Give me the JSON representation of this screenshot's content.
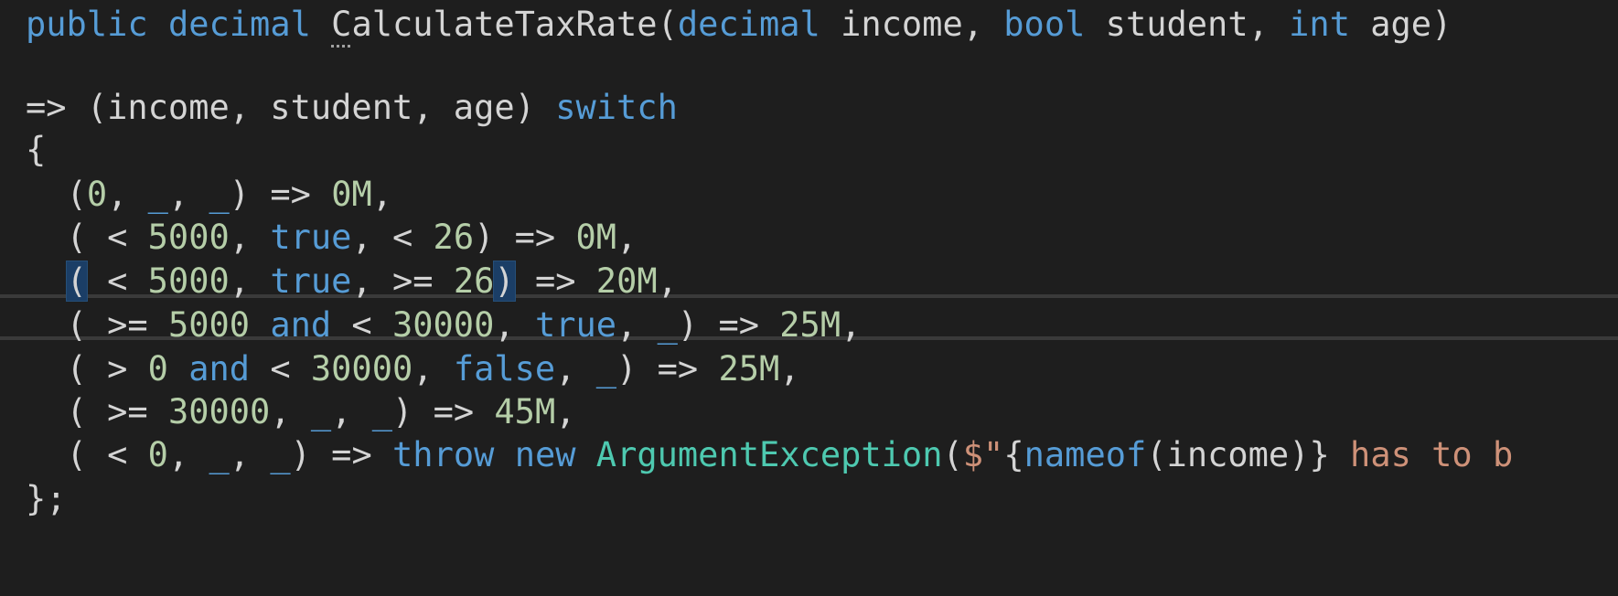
{
  "colors": {
    "background": "#1e1e1e",
    "default": "#d4d4d4",
    "keyword": "#569cd6",
    "number": "#b5cea8",
    "type": "#4ec9b0",
    "string": "#ce9178",
    "current_line_border": "#3a3a3a",
    "bracket_match": "#1b3e66"
  },
  "editor": {
    "lines": [
      {
        "tokens": [
          {
            "text": "public",
            "kind": "keyword"
          },
          {
            "text": " ",
            "kind": "default"
          },
          {
            "text": "decimal",
            "kind": "keyword"
          },
          {
            "text": " ",
            "kind": "default"
          },
          {
            "text": "C",
            "kind": "default",
            "dotted": true
          },
          {
            "text": "alculateTaxRate(",
            "kind": "default"
          },
          {
            "text": "decimal",
            "kind": "keyword"
          },
          {
            "text": " income, ",
            "kind": "default"
          },
          {
            "text": "bool",
            "kind": "keyword"
          },
          {
            "text": " student, ",
            "kind": "default"
          },
          {
            "text": "int",
            "kind": "keyword"
          },
          {
            "text": " age)",
            "kind": "default"
          }
        ]
      },
      {
        "tokens": []
      },
      {
        "tokens": [
          {
            "text": "=> (income, student, age) ",
            "kind": "default"
          },
          {
            "text": "switch",
            "kind": "keyword"
          }
        ]
      },
      {
        "tokens": [
          {
            "text": "{",
            "kind": "default"
          }
        ]
      },
      {
        "tokens": [
          {
            "text": "  (",
            "kind": "default"
          },
          {
            "text": "0",
            "kind": "number"
          },
          {
            "text": ", ",
            "kind": "default"
          },
          {
            "text": "_",
            "kind": "keyword"
          },
          {
            "text": ", ",
            "kind": "default"
          },
          {
            "text": "_",
            "kind": "keyword"
          },
          {
            "text": ") => ",
            "kind": "default"
          },
          {
            "text": "0M",
            "kind": "number"
          },
          {
            "text": ",",
            "kind": "default"
          }
        ]
      },
      {
        "tokens": [
          {
            "text": "  ( < ",
            "kind": "default"
          },
          {
            "text": "5000",
            "kind": "number"
          },
          {
            "text": ", ",
            "kind": "default"
          },
          {
            "text": "true",
            "kind": "keyword"
          },
          {
            "text": ", < ",
            "kind": "default"
          },
          {
            "text": "26",
            "kind": "number"
          },
          {
            "text": ") => ",
            "kind": "default"
          },
          {
            "text": "0M",
            "kind": "number"
          },
          {
            "text": ",",
            "kind": "default"
          }
        ]
      },
      {
        "current": true,
        "tokens": [
          {
            "text": "  ",
            "kind": "default"
          },
          {
            "text": "(",
            "kind": "default",
            "match": true
          },
          {
            "text": " < ",
            "kind": "default"
          },
          {
            "text": "5000",
            "kind": "number"
          },
          {
            "text": ", ",
            "kind": "default"
          },
          {
            "text": "true",
            "kind": "keyword"
          },
          {
            "text": ", >= ",
            "kind": "default"
          },
          {
            "text": "26",
            "kind": "number"
          },
          {
            "text": ")",
            "kind": "default",
            "match": true
          },
          {
            "text": " => ",
            "kind": "default"
          },
          {
            "text": "20M",
            "kind": "number"
          },
          {
            "text": ",",
            "kind": "default"
          }
        ]
      },
      {
        "tokens": [
          {
            "text": "  ( >= ",
            "kind": "default"
          },
          {
            "text": "5000",
            "kind": "number"
          },
          {
            "text": " ",
            "kind": "default"
          },
          {
            "text": "and",
            "kind": "keyword"
          },
          {
            "text": " < ",
            "kind": "default"
          },
          {
            "text": "30000",
            "kind": "number"
          },
          {
            "text": ", ",
            "kind": "default"
          },
          {
            "text": "true",
            "kind": "keyword"
          },
          {
            "text": ", ",
            "kind": "default"
          },
          {
            "text": "_",
            "kind": "keyword"
          },
          {
            "text": ") => ",
            "kind": "default"
          },
          {
            "text": "25M",
            "kind": "number"
          },
          {
            "text": ",",
            "kind": "default"
          }
        ]
      },
      {
        "tokens": [
          {
            "text": "  ( > ",
            "kind": "default"
          },
          {
            "text": "0",
            "kind": "number"
          },
          {
            "text": " ",
            "kind": "default"
          },
          {
            "text": "and",
            "kind": "keyword"
          },
          {
            "text": " < ",
            "kind": "default"
          },
          {
            "text": "30000",
            "kind": "number"
          },
          {
            "text": ", ",
            "kind": "default"
          },
          {
            "text": "false",
            "kind": "keyword"
          },
          {
            "text": ", ",
            "kind": "default"
          },
          {
            "text": "_",
            "kind": "keyword"
          },
          {
            "text": ") => ",
            "kind": "default"
          },
          {
            "text": "25M",
            "kind": "number"
          },
          {
            "text": ",",
            "kind": "default"
          }
        ]
      },
      {
        "tokens": [
          {
            "text": "  ( >= ",
            "kind": "default"
          },
          {
            "text": "30000",
            "kind": "number"
          },
          {
            "text": ", ",
            "kind": "default"
          },
          {
            "text": "_",
            "kind": "keyword"
          },
          {
            "text": ", ",
            "kind": "default"
          },
          {
            "text": "_",
            "kind": "keyword"
          },
          {
            "text": ") => ",
            "kind": "default"
          },
          {
            "text": "45M",
            "kind": "number"
          },
          {
            "text": ",",
            "kind": "default"
          }
        ]
      },
      {
        "tokens": [
          {
            "text": "  ( < ",
            "kind": "default"
          },
          {
            "text": "0",
            "kind": "number"
          },
          {
            "text": ", ",
            "kind": "default"
          },
          {
            "text": "_",
            "kind": "keyword"
          },
          {
            "text": ", ",
            "kind": "default"
          },
          {
            "text": "_",
            "kind": "keyword"
          },
          {
            "text": ") => ",
            "kind": "default"
          },
          {
            "text": "throw",
            "kind": "keyword"
          },
          {
            "text": " ",
            "kind": "default"
          },
          {
            "text": "new",
            "kind": "keyword"
          },
          {
            "text": " ",
            "kind": "default"
          },
          {
            "text": "ArgumentException",
            "kind": "type"
          },
          {
            "text": "(",
            "kind": "default"
          },
          {
            "text": "$\"",
            "kind": "string"
          },
          {
            "text": "{",
            "kind": "default"
          },
          {
            "text": "nameof",
            "kind": "keyword"
          },
          {
            "text": "(income)}",
            "kind": "default"
          },
          {
            "text": " has to b",
            "kind": "string"
          }
        ]
      },
      {
        "tokens": [
          {
            "text": "};",
            "kind": "default"
          }
        ]
      }
    ]
  }
}
